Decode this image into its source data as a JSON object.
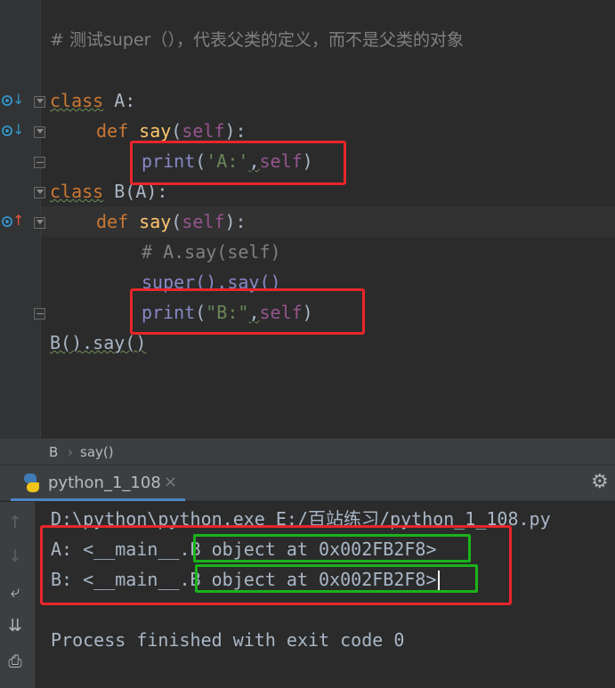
{
  "editor": {
    "comment": "# 测试super（），代表父类的定义，而不是父类的对象",
    "lines": {
      "class_a_kw": "class",
      "class_a_name": " A:",
      "def1_kw": "def",
      "def1_name": "say",
      "def1_open": "(",
      "def1_self": "self",
      "def1_close": "):",
      "print1_fn": "print",
      "print1_open": "(",
      "print1_str": "'A:'",
      "print1_comma": ",",
      "print1_self": "self",
      "print1_close": ")",
      "class_b_kw": "class",
      "class_b_name": " B(A):",
      "def2_kw": "def",
      "def2_name": "say",
      "def2_open": "(",
      "def2_self": "self",
      "def2_close": "):",
      "inner_comment": "# A.say(self)",
      "super_call": "super().say()",
      "print2_fn": "print",
      "print2_open": "(",
      "print2_str": "\"B:\"",
      "print2_comma": ",",
      "print2_self": "self",
      "print2_close": ")",
      "main_call": "B().say()"
    }
  },
  "breadcrumb": {
    "class": "B",
    "separator": "›",
    "method": "say()"
  },
  "run": {
    "tab_label": "python_1_108",
    "close_glyph": "×",
    "console": {
      "command": "D:\\python\\python.exe E:/百站练习/python_1_108.py",
      "out_a_prefix": "A: <__main__.",
      "out_a_obj": "B object at 0x002FB2F8>",
      "out_b_prefix": "B: <__main__.",
      "out_b_obj": "B object at 0x002FB2F8>",
      "exit": "Process finished with exit code 0"
    }
  },
  "icons": {
    "gear": "⚙",
    "rerun_up": "↑",
    "rerun_down": "↓",
    "soft_wrap": "⤶",
    "scroll_end": "⇊",
    "print": "⎙"
  },
  "colors": {
    "annotation_red": "#e8262b",
    "annotation_green": "#1ab31a",
    "keyword": "#cc7832",
    "function": "#ffc66d",
    "self": "#94558d",
    "string": "#6a8759"
  }
}
